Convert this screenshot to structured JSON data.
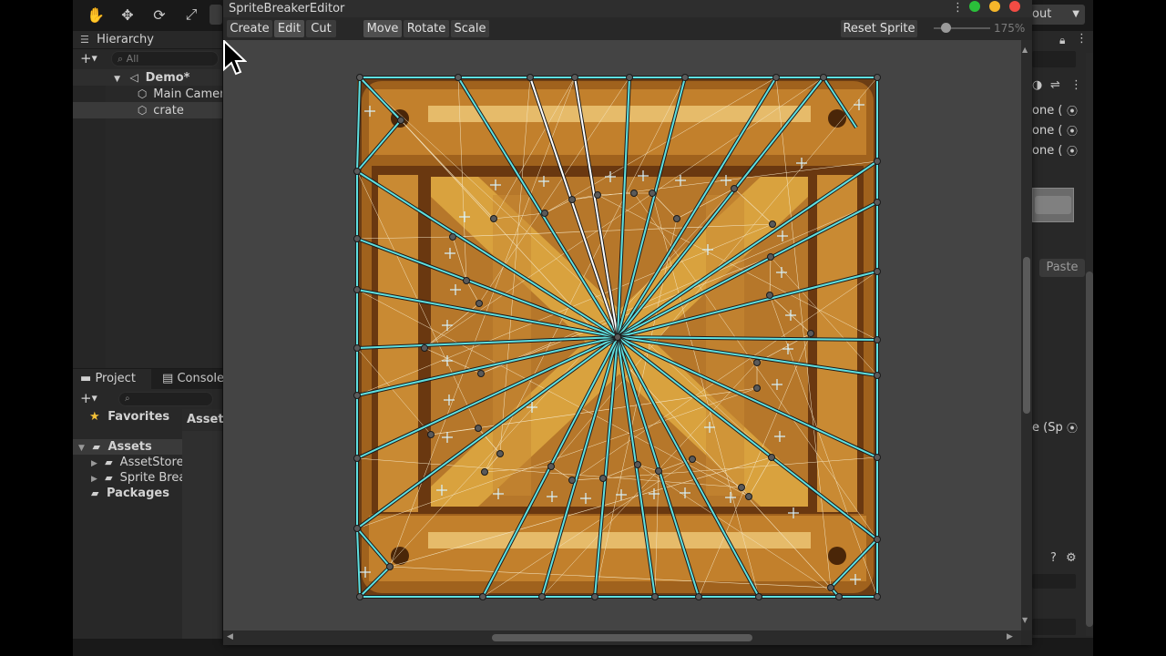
{
  "main_toolbar": {
    "tools": [
      "hand-tool",
      "move-tool",
      "rotate-tool",
      "scale-tool",
      "rect-tool"
    ],
    "layout_dropdown": "out"
  },
  "hierarchy": {
    "tab_label": "Hierarchy",
    "search_placeholder": "All",
    "items": [
      {
        "label": "Demo*",
        "type": "scene"
      },
      {
        "label": "Main Camera",
        "type": "gameobject"
      },
      {
        "label": "crate",
        "type": "gameobject",
        "selected": true
      }
    ]
  },
  "project": {
    "tab_label": "Project",
    "console_tab_label": "Console",
    "favorites_label": "Favorites",
    "assets_label": "Assets",
    "children": [
      "AssetStore",
      "Sprite Brea"
    ],
    "packages_label": "Packages",
    "right_header": "Asset"
  },
  "inspector": {
    "fields": [
      "one (",
      "one (",
      "one ("
    ],
    "paste_label": "Paste",
    "sprite_field": "e (Sp"
  },
  "sprite_breaker": {
    "title": "SpriteBreakerEditor",
    "mode_buttons": {
      "create": "Create",
      "edit": "Edit",
      "cut": "Cut"
    },
    "active_mode": "Edit",
    "transform_buttons": {
      "move": "Move",
      "rotate": "Rotate",
      "scale": "Scale"
    },
    "active_transform": "Move",
    "reset_label": "Reset Sprite",
    "zoom": "175%",
    "sprite_name": "crate",
    "colors": {
      "edge": "#5fe0e0",
      "selected_edge": "#ffffff",
      "vertex": "#5a5a5a",
      "crate_light": "#d9a23e",
      "crate_dark": "#6e3c12"
    }
  }
}
